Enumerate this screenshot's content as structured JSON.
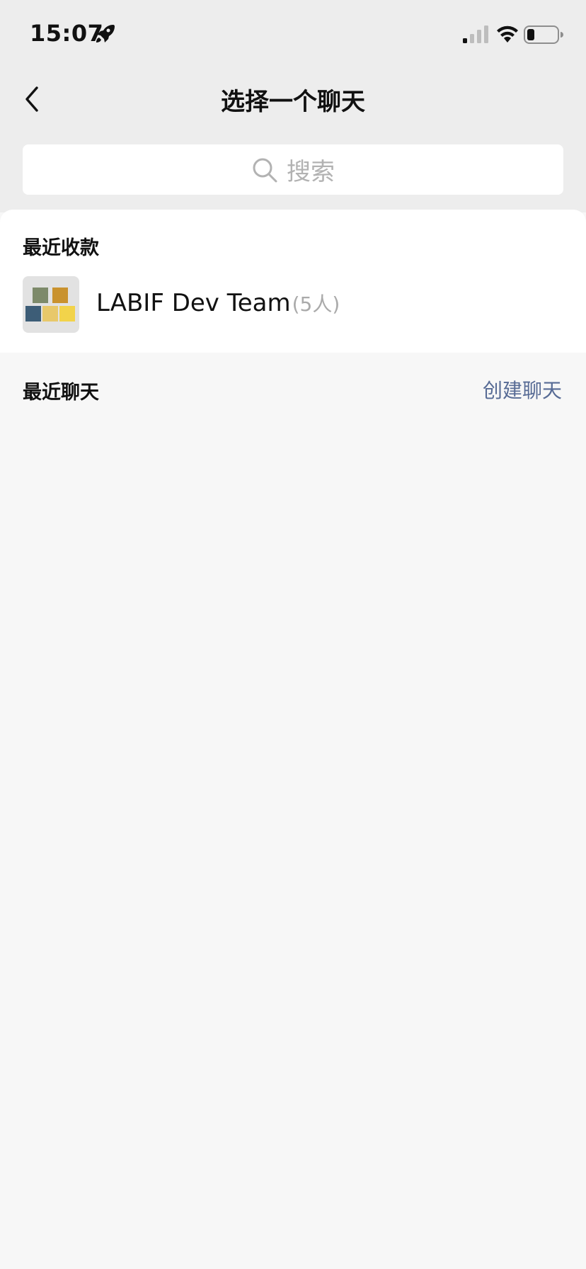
{
  "status_bar": {
    "time": "15:07"
  },
  "nav": {
    "title": "选择一个聊天"
  },
  "search": {
    "placeholder": "搜索"
  },
  "recent_payments": {
    "title": "最近收款",
    "items": [
      {
        "name": "LABIF Dev Team",
        "count": "(5人)"
      }
    ]
  },
  "recent_chats": {
    "title": "最近聊天",
    "create_label": "创建聊天"
  },
  "colors": {
    "link": "#576b95",
    "muted": "#aaaaaa",
    "top_bg": "#ededed",
    "page_bg": "#f7f7f7"
  },
  "icons": [
    "rocket-icon",
    "signal-icon",
    "wifi-icon",
    "battery-icon",
    "back-icon",
    "search-icon"
  ]
}
